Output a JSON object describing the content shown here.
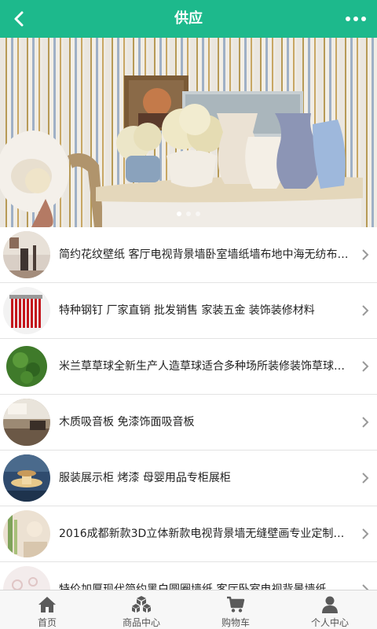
{
  "header": {
    "title": "供应",
    "colors": {
      "background": "#1db98c",
      "foreground": "#ffffff"
    }
  },
  "banner": {
    "slide_count": 3,
    "active_index": 0
  },
  "products": [
    {
      "title": "简约花纹壁纸 客厅电视背景墙卧室墙纸墙布地中海无纺布墙纸"
    },
    {
      "title": "特种钢钉 厂家直销 批发销售 家装五金 装饰装修材料"
    },
    {
      "title": "米兰草草球全新生产人造草球适合多种场所装修装饰草球批发"
    },
    {
      "title": "木质吸音板 免漆饰面吸音板"
    },
    {
      "title": "服装展示柜 烤漆 母婴用品专柜展柜"
    },
    {
      "title": "2016成都新款3D立体新款电视背景墙无缝壁画专业定制厂家"
    },
    {
      "title": "特价加厚现代简约黑白圆圈墙纸 客厅卧室电视背景墙纸"
    }
  ],
  "tabbar": {
    "items": [
      {
        "label": "首页",
        "icon": "home-icon"
      },
      {
        "label": "商品中心",
        "icon": "boxes-icon"
      },
      {
        "label": "购物车",
        "icon": "cart-icon"
      },
      {
        "label": "个人中心",
        "icon": "user-icon"
      }
    ]
  }
}
